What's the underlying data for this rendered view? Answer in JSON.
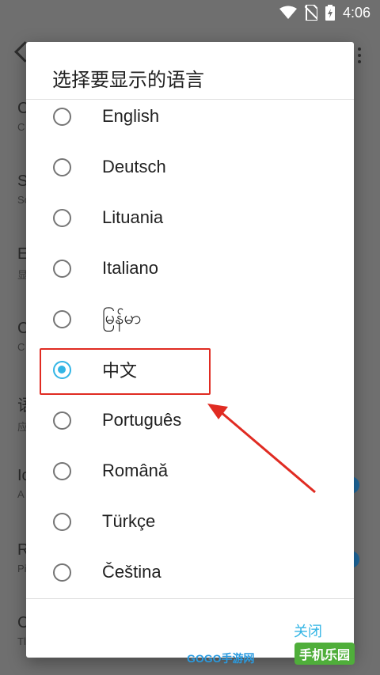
{
  "status_bar": {
    "time": "4:06"
  },
  "background": {
    "rows": [
      {
        "title": "C",
        "subtitle": "C"
      },
      {
        "title": "S",
        "subtitle": "Sc"
      },
      {
        "title": "E",
        "subtitle": "显"
      },
      {
        "title": "C",
        "subtitle": "C"
      },
      {
        "title": "语",
        "subtitle": "应"
      },
      {
        "title": "Io",
        "subtitle": "A"
      },
      {
        "title": "R",
        "subtitle": "Pi"
      },
      {
        "title": "C",
        "subtitle": "Tl"
      }
    ]
  },
  "dialog": {
    "title": "选择要显示的语言",
    "options": [
      {
        "label": "English",
        "checked": false
      },
      {
        "label": "Deutsch",
        "checked": false
      },
      {
        "label": "Lituania",
        "checked": false
      },
      {
        "label": "Italiano",
        "checked": false
      },
      {
        "label": "မြန်မာ",
        "checked": false
      },
      {
        "label": "中文",
        "checked": true
      },
      {
        "label": "Português",
        "checked": false
      },
      {
        "label": "Română",
        "checked": false
      },
      {
        "label": "Türkçe",
        "checked": false
      },
      {
        "label": "Čeština",
        "checked": false
      }
    ],
    "close_label": "关闭"
  },
  "watermarks": {
    "left": "GOGO手游网",
    "right": "手机乐园"
  },
  "colors": {
    "accent": "#33b5e5",
    "annotation": "#e02b22"
  }
}
